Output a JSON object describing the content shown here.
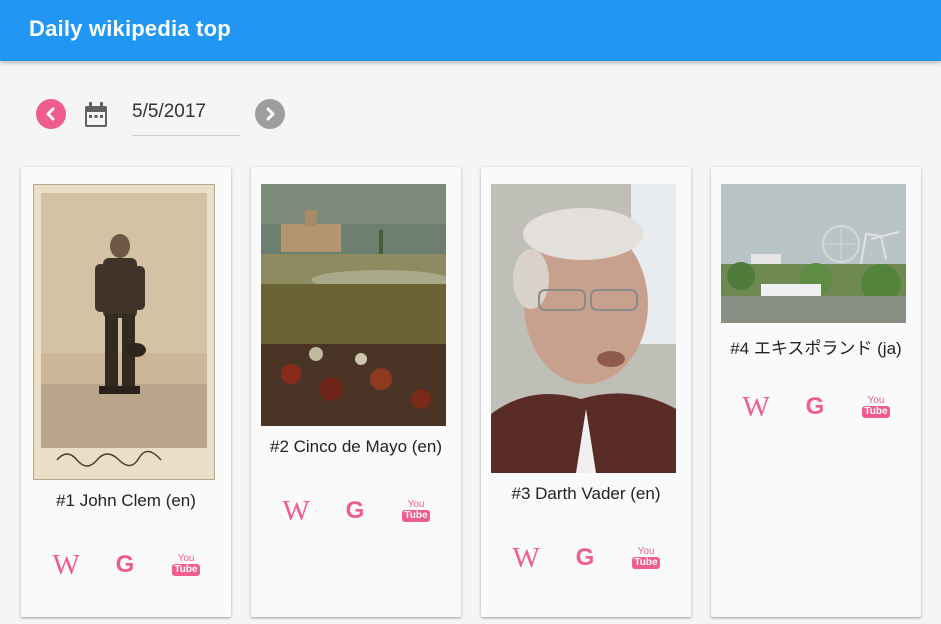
{
  "app": {
    "title": "Daily wikipedia top"
  },
  "date_picker": {
    "value": "5/5/2017"
  },
  "link_icons": {
    "wikipedia": "W",
    "google": "G",
    "youtube_top": "You",
    "youtube_bottom": "Tube"
  },
  "cards": [
    {
      "caption": "#1  John Clem (en)",
      "image": "portrait of a young boy in uniform (sepia photo card)",
      "image_inscription": "Johnny Clem"
    },
    {
      "caption": "#2  Cinco de Mayo (en)",
      "image": "battle painting"
    },
    {
      "caption": "#3  Darth Vader (en)",
      "image": "photo of an elderly man"
    },
    {
      "caption": "#4  エキスポランド (ja)",
      "image": "amusement park with ferris wheel"
    }
  ],
  "colors": {
    "appbar": "#2196f3",
    "accent": "#ef5d8e",
    "disabled": "#9e9e9e"
  }
}
